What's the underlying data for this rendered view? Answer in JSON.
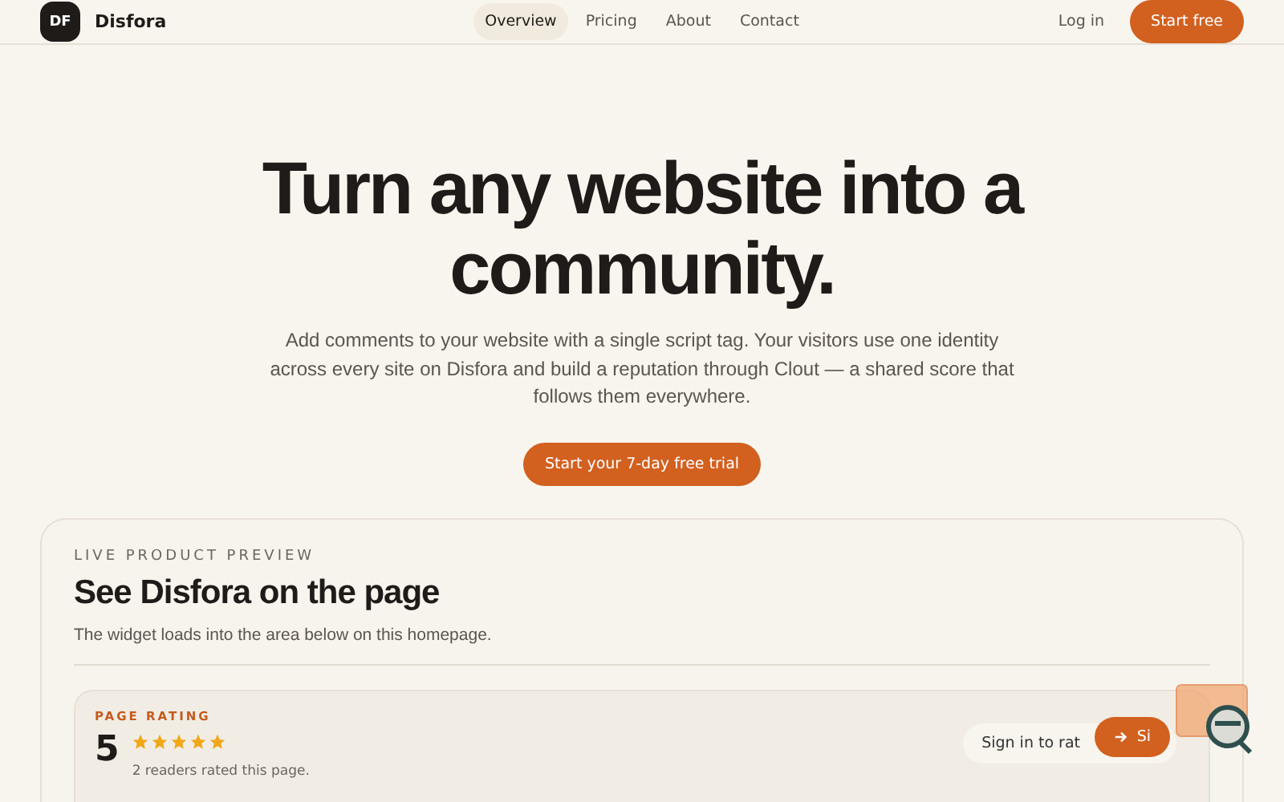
{
  "brand": {
    "logo": "DF",
    "name": "Disfora"
  },
  "nav": [
    {
      "label": "Overview",
      "selected": true
    },
    {
      "label": "Pricing",
      "selected": false
    },
    {
      "label": "About",
      "selected": false
    },
    {
      "label": "Contact",
      "selected": false
    }
  ],
  "actions": {
    "login": "Log in",
    "cta": "Start free"
  },
  "hero": {
    "title": "Turn any website into a community.",
    "text": "Add comments to your website with a single script tag. Your visitors use one identity across every site on Disfora and build a reputation through Clout — a shared score that follows them everywhere.",
    "button": "Start your 7-day free trial"
  },
  "preview": {
    "eyebrow": "LIVE PRODUCT PREVIEW",
    "title": "See Disfora on the page",
    "text": "The widget loads into the area below on this homepage.",
    "widget": {
      "label": "PAGE RATING",
      "score": "5",
      "stars": 5,
      "count": "2 readers rated this page.",
      "sign_in": "Sign in to rat",
      "button": "Si"
    }
  }
}
